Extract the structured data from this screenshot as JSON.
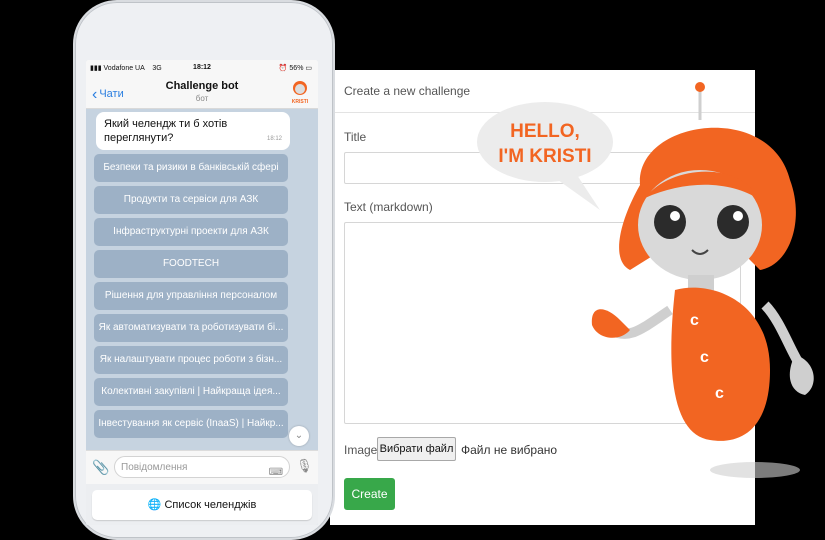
{
  "phone": {
    "status": {
      "carrier": "Vodafone UA",
      "network": "3G",
      "time": "18:12",
      "battery": "56%"
    },
    "header": {
      "back_label": "Чати",
      "title": "Challenge bot",
      "subtitle": "бот",
      "avatar_label": "KRISTI"
    },
    "bot_message": {
      "text": "Який челендж ти б хотів переглянути?",
      "time": "18:12"
    },
    "keyboard_buttons": [
      "Безпеки та ризики в банківській сфері",
      "Продукти та сервіси для АЗК",
      "Інфраструктурні проекти для АЗК",
      "FOODTECH",
      "Рішення для управління персоналом",
      "Як автоматизувати та роботизувати бі...",
      "Як налаштувати процес роботи з бізн...",
      "Колективні закупівлі | Найкраща ідея...",
      "Інвестування як сервіс (InaaS) | Найкр..."
    ],
    "input_placeholder": "Повідомлення",
    "challenges_button": "Список челенджів",
    "challenges_button_icon": "🌐"
  },
  "web_form": {
    "header": "Create a new challenge",
    "title_label": "Title",
    "text_label": "Text (markdown)",
    "image_label": "Image",
    "choose_file": "Вибрати файл",
    "no_file": "Файл не вибрано",
    "create_button": "Create"
  },
  "mascot": {
    "speech_line1": "HELLO,",
    "speech_line2": "I'M KRISTI",
    "body_letter": "c"
  },
  "colors": {
    "accent_orange": "#f26522",
    "create_green": "#38a84a",
    "link_blue": "#2a7ee0"
  }
}
